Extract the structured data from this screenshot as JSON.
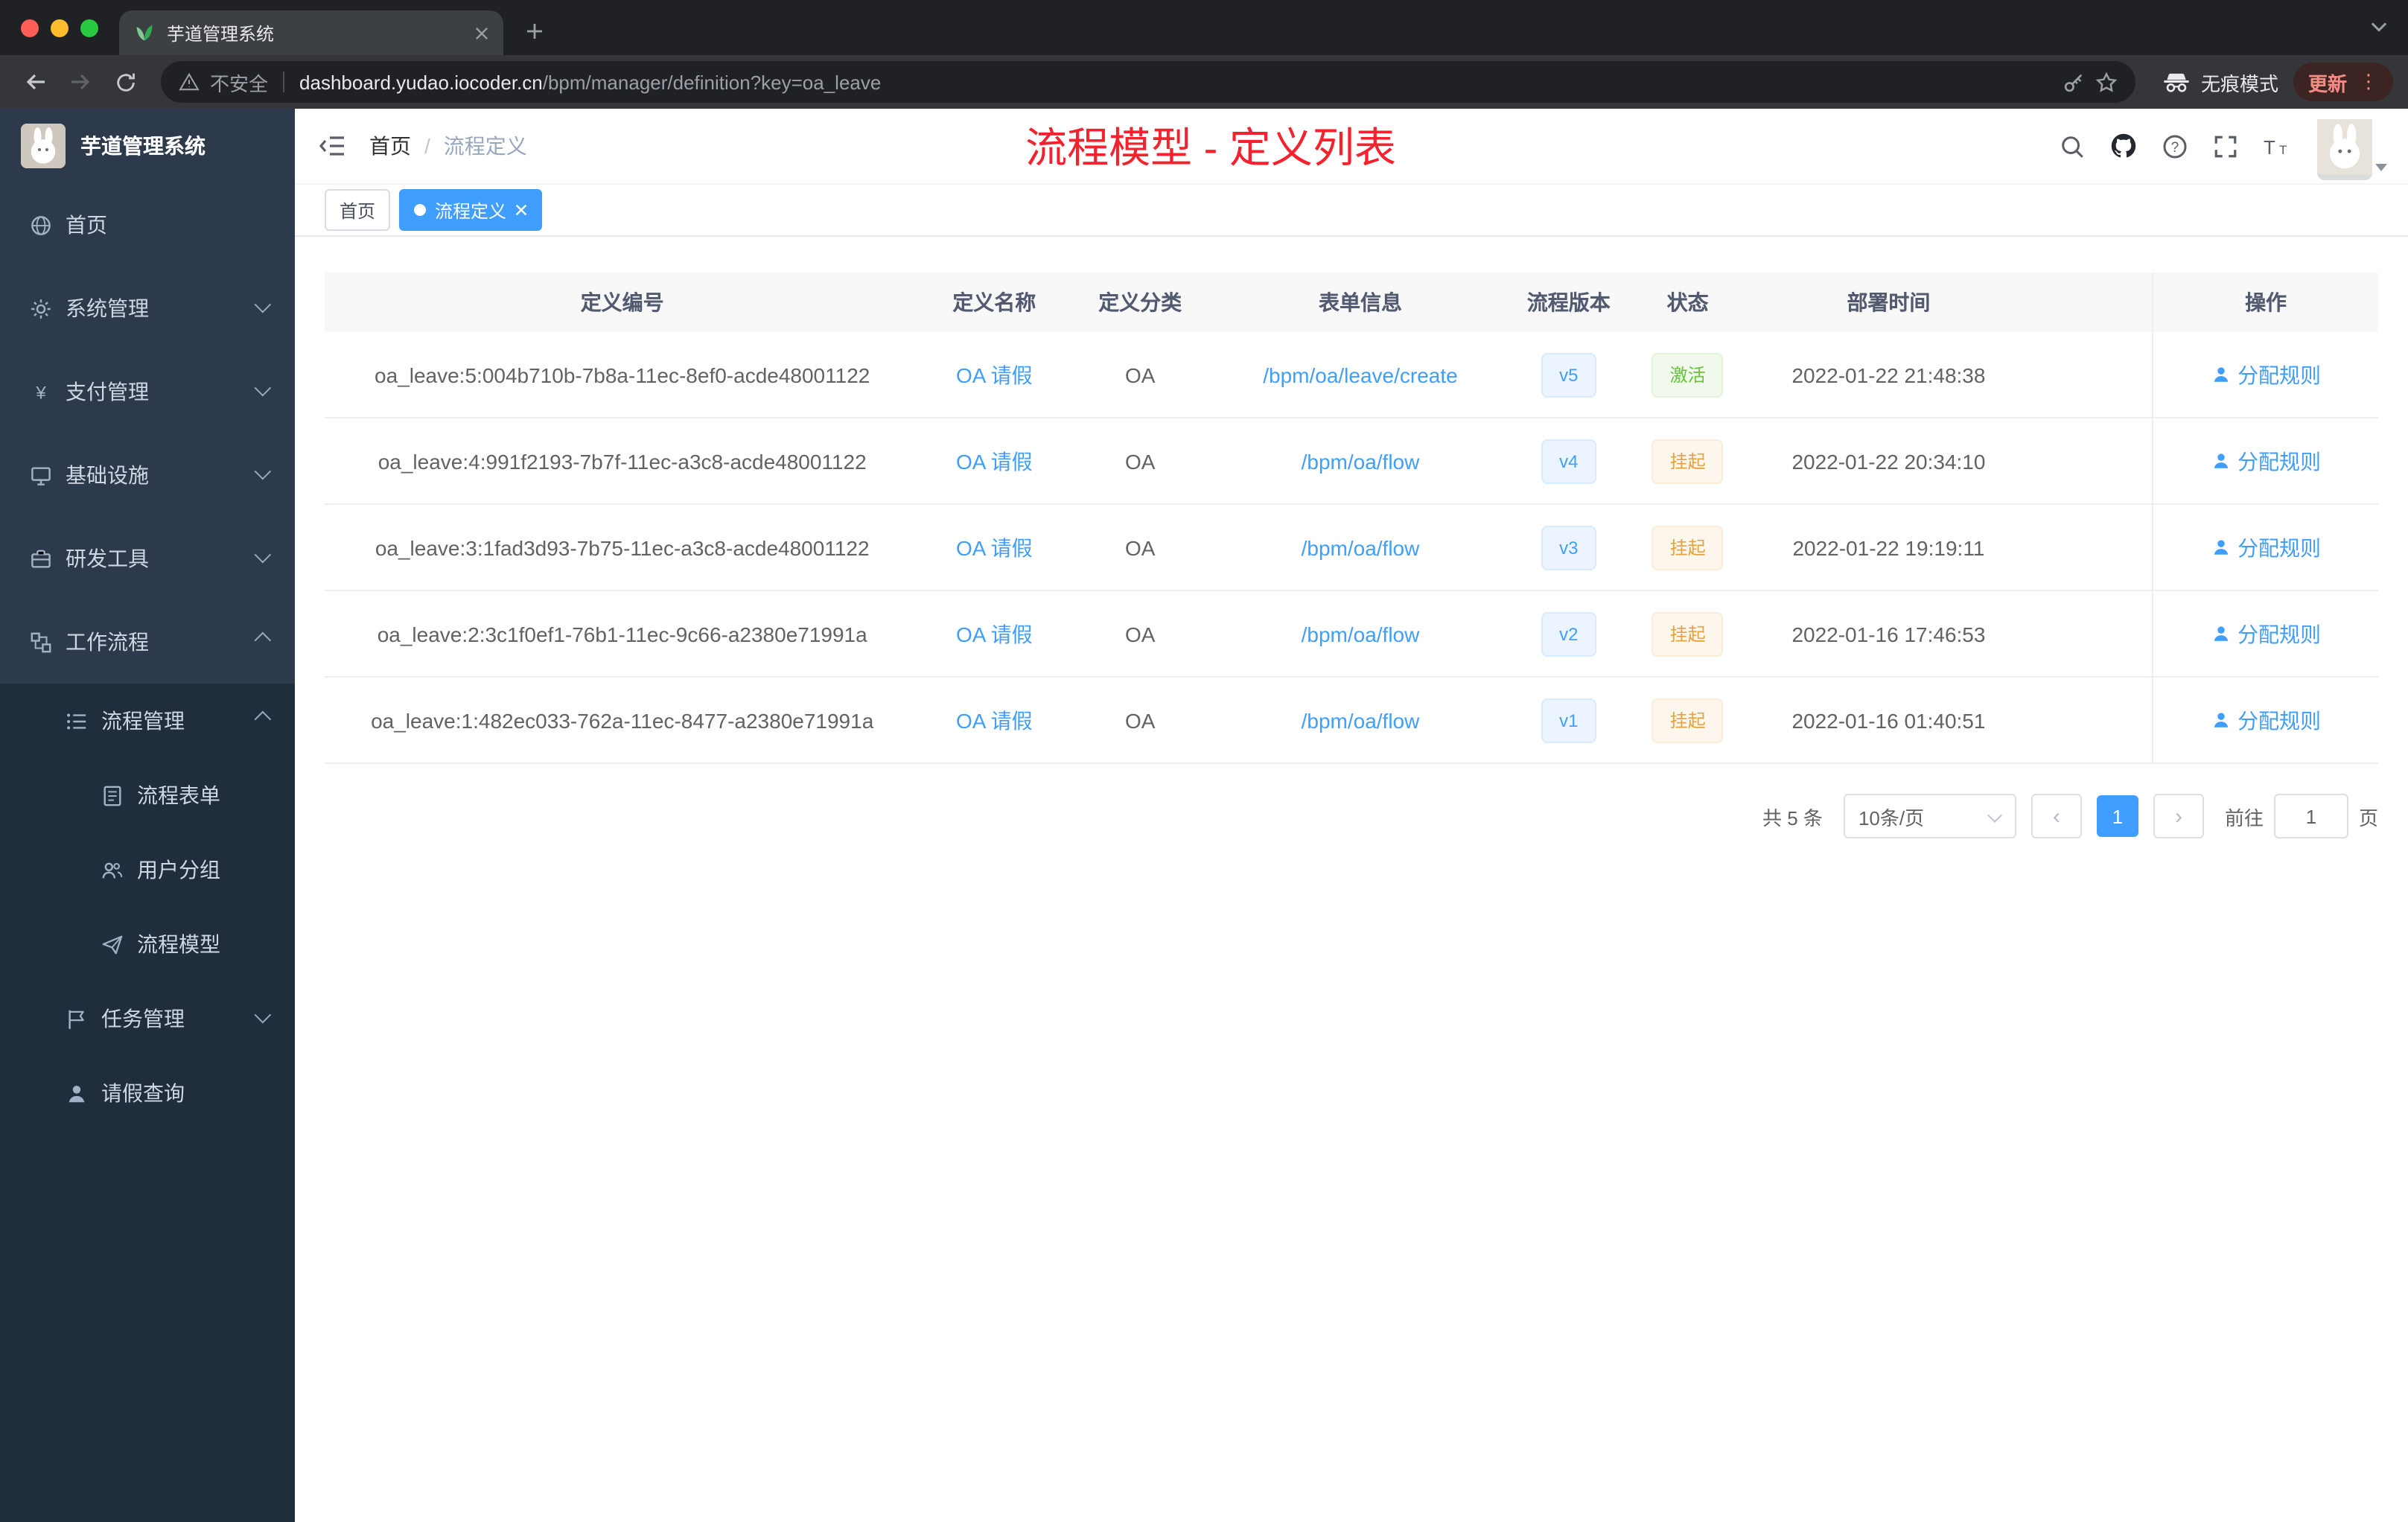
{
  "colors": {
    "accent": "#409eff",
    "success": "#67c23a",
    "warning": "#e6a23c",
    "annotation_red": "#f5222d",
    "sidebar_bg": "#2d3a4b",
    "sidebar_submenu_bg": "#1f2d3d"
  },
  "browser": {
    "tab": {
      "title": "芋道管理系统"
    },
    "address": {
      "security_label": "不安全",
      "domain": "dashboard.yudao.iocoder.cn",
      "path": "/bpm/manager/definition?key=oa_leave"
    },
    "incognito_label": "无痕模式",
    "update_label": "更新"
  },
  "sidebar": {
    "logo_title": "芋道管理系统",
    "items": [
      {
        "name": "home",
        "label": "首页",
        "icon": "home-icon",
        "level": 1
      },
      {
        "name": "system-management",
        "label": "系统管理",
        "icon": "gear-icon",
        "level": 1,
        "chevron": "down"
      },
      {
        "name": "payment-management",
        "label": "支付管理",
        "icon": "payment-icon",
        "level": 1,
        "chevron": "down"
      },
      {
        "name": "infrastructure",
        "label": "基础设施",
        "icon": "infrastructure-icon",
        "level": 1,
        "chevron": "down"
      },
      {
        "name": "dev-tools",
        "label": "研发工具",
        "icon": "dev-tools-icon",
        "level": 1,
        "chevron": "down"
      },
      {
        "name": "workflow",
        "label": "工作流程",
        "icon": "workflow-icon",
        "level": 1,
        "chevron": "up"
      },
      {
        "name": "process-management",
        "label": "流程管理",
        "icon": "process-manage-icon",
        "level": 2,
        "chevron": "up"
      },
      {
        "name": "process-form",
        "label": "流程表单",
        "icon": "form-icon",
        "level": 3
      },
      {
        "name": "user-group",
        "label": "用户分组",
        "icon": "user-group-icon",
        "level": 3
      },
      {
        "name": "process-model",
        "label": "流程模型",
        "icon": "model-icon",
        "level": 3
      },
      {
        "name": "task-management",
        "label": "任务管理",
        "icon": "task-icon",
        "level": 2,
        "chevron": "down"
      },
      {
        "name": "leave-query",
        "label": "请假查询",
        "icon": "person-icon",
        "level": 2
      }
    ]
  },
  "header": {
    "breadcrumb": {
      "items": [
        "首页",
        "流程定义"
      ],
      "separator": "/"
    },
    "annotation": "流程模型 - 定义列表"
  },
  "tags": {
    "items": [
      {
        "label": "首页",
        "active": false
      },
      {
        "label": "流程定义",
        "active": true
      }
    ]
  },
  "table": {
    "columns": [
      "定义编号",
      "定义名称",
      "定义分类",
      "表单信息",
      "流程版本",
      "状态",
      "部署时间",
      "操作"
    ],
    "rows": [
      {
        "id": "oa_leave:5:004b710b-7b8a-11ec-8ef0-acde48001122",
        "name": "OA 请假",
        "category": "OA",
        "form": "/bpm/oa/leave/create",
        "version": "v5",
        "status": "激活",
        "status_type": "success",
        "time": "2022-01-22 21:48:38",
        "action": "分配规则"
      },
      {
        "id": "oa_leave:4:991f2193-7b7f-11ec-a3c8-acde48001122",
        "name": "OA 请假",
        "category": "OA",
        "form": "/bpm/oa/flow",
        "version": "v4",
        "status": "挂起",
        "status_type": "warning",
        "time": "2022-01-22 20:34:10",
        "action": "分配规则"
      },
      {
        "id": "oa_leave:3:1fad3d93-7b75-11ec-a3c8-acde48001122",
        "name": "OA 请假",
        "category": "OA",
        "form": "/bpm/oa/flow",
        "version": "v3",
        "status": "挂起",
        "status_type": "warning",
        "time": "2022-01-22 19:19:11",
        "action": "分配规则"
      },
      {
        "id": "oa_leave:2:3c1f0ef1-76b1-11ec-9c66-a2380e71991a",
        "name": "OA 请假",
        "category": "OA",
        "form": "/bpm/oa/flow",
        "version": "v2",
        "status": "挂起",
        "status_type": "warning",
        "time": "2022-01-16 17:46:53",
        "action": "分配规则"
      },
      {
        "id": "oa_leave:1:482ec033-762a-11ec-8477-a2380e71991a",
        "name": "OA 请假",
        "category": "OA",
        "form": "/bpm/oa/flow",
        "version": "v1",
        "status": "挂起",
        "status_type": "warning",
        "time": "2022-01-16 01:40:51",
        "action": "分配规则"
      }
    ]
  },
  "pagination": {
    "total": "共 5 条",
    "page_size": "10条/页",
    "current_page": "1",
    "goto_label": "前往",
    "goto_value": "1",
    "page_unit": "页"
  }
}
